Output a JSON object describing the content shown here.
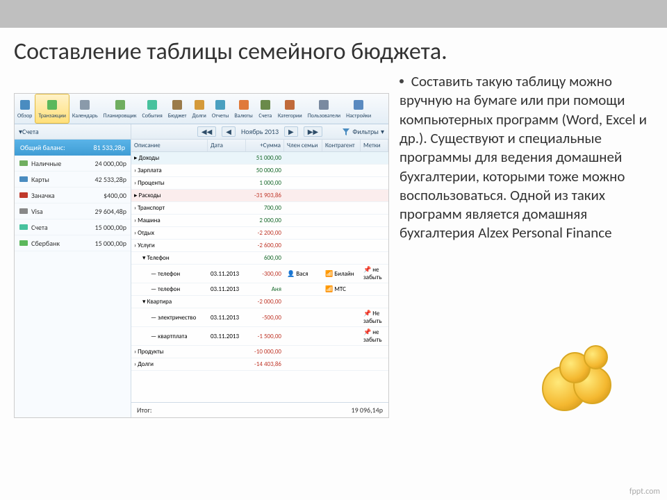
{
  "slide": {
    "title": "Составление таблицы семейного бюджета.",
    "description": "Составить такую таблицу можно вручную на бумаге или при помощи компьютерных программ (Word, Excel и др.). Существуют и специальные программы для ведения домашней бухгалтерии, которыми тоже можно воспользоваться. Одной из таких программ является домашняя бухгалтерия Alzex Personal Finance",
    "watermark": "fppt.com"
  },
  "toolbar": [
    {
      "label": "Обзор",
      "active": false
    },
    {
      "label": "Транзакции",
      "active": true
    },
    {
      "label": "Календарь",
      "active": false
    },
    {
      "label": "Планировщик",
      "active": false
    },
    {
      "label": "События",
      "active": false
    },
    {
      "label": "Бюджет",
      "active": false
    },
    {
      "label": "Долги",
      "active": false
    },
    {
      "label": "Отчеты",
      "active": false
    },
    {
      "label": "Валюты",
      "active": false
    },
    {
      "label": "Счета",
      "active": false
    },
    {
      "label": "Категории",
      "active": false
    },
    {
      "label": "Пользователи",
      "active": false
    },
    {
      "label": "Настройки",
      "active": false
    }
  ],
  "sidebar": {
    "header": "Счета",
    "balance_label": "Общий баланс:",
    "balance_value": "81 533,28p",
    "accounts": [
      {
        "name": "Наличные",
        "value": "24 000,00p"
      },
      {
        "name": "Карты",
        "value": "42 533,28p"
      },
      {
        "name": "Заначка",
        "value": "$400,00"
      },
      {
        "name": "Visa",
        "value": "29 604,48p"
      },
      {
        "name": "Счета",
        "value": "15 000,00p"
      },
      {
        "name": "Сбербанк",
        "value": "15 000,00p"
      }
    ]
  },
  "date_bar": {
    "period": "Ноябрь 2013",
    "filter_label": "Фильтры"
  },
  "table": {
    "headers": {
      "desc": "Описание",
      "date": "Дата",
      "sum": "+Сумма",
      "member": "Член семьи",
      "agent": "Контрагент",
      "tags": "Метки"
    },
    "rows": [
      {
        "kind": "income",
        "desc": "Доходы",
        "date": "",
        "sum": "51 000,00",
        "neg": false
      },
      {
        "kind": "plain",
        "desc": "Зарплата",
        "date": "",
        "sum": "50 000,00",
        "neg": false
      },
      {
        "kind": "plain",
        "desc": "Проценты",
        "date": "",
        "sum": "1 000,00",
        "neg": false
      },
      {
        "kind": "expense",
        "desc": "Расходы",
        "date": "",
        "sum": "-31 903,86",
        "neg": true
      },
      {
        "kind": "plain",
        "desc": "Транспорт",
        "date": "",
        "sum": "700,00",
        "neg": false
      },
      {
        "kind": "plain",
        "desc": "Машина",
        "date": "",
        "sum": "2 000,00",
        "neg": false
      },
      {
        "kind": "plain",
        "desc": "Отдых",
        "date": "",
        "sum": "-2 200,00",
        "neg": true
      },
      {
        "kind": "plain",
        "desc": "Услуги",
        "date": "",
        "sum": "-2 600,00",
        "neg": true
      },
      {
        "kind": "sub",
        "desc": "Телефон",
        "date": "",
        "sum": "600,00",
        "neg": false
      },
      {
        "kind": "leaf",
        "desc": "телефон",
        "date": "03.11.2013",
        "sum": "-300,00",
        "neg": true,
        "member": "Вася",
        "agent": "Билайн",
        "tag": "не забыть"
      },
      {
        "kind": "leaf",
        "desc": "телефон",
        "date": "03.11.2013",
        "sum": "Аня",
        "neg": false,
        "member": "",
        "agent": "МТС",
        "tag": ""
      },
      {
        "kind": "sub",
        "desc": "Квартира",
        "date": "",
        "sum": "-2 000,00",
        "neg": true
      },
      {
        "kind": "leaf",
        "desc": "электричество",
        "date": "03.11.2013",
        "sum": "-500,00",
        "neg": true,
        "member": "",
        "agent": "",
        "tag": "Не забыть"
      },
      {
        "kind": "leaf",
        "desc": "квартплата",
        "date": "03.11.2013",
        "sum": "-1 500,00",
        "neg": true,
        "member": "",
        "agent": "",
        "tag": "не забыть"
      },
      {
        "kind": "plain",
        "desc": "Продукты",
        "date": "",
        "sum": "-10 000,00",
        "neg": true
      },
      {
        "kind": "plain",
        "desc": "Долги",
        "date": "",
        "sum": "-14 403,86",
        "neg": true
      }
    ],
    "footer_label": "Итог:",
    "footer_value": "19 096,14p"
  }
}
